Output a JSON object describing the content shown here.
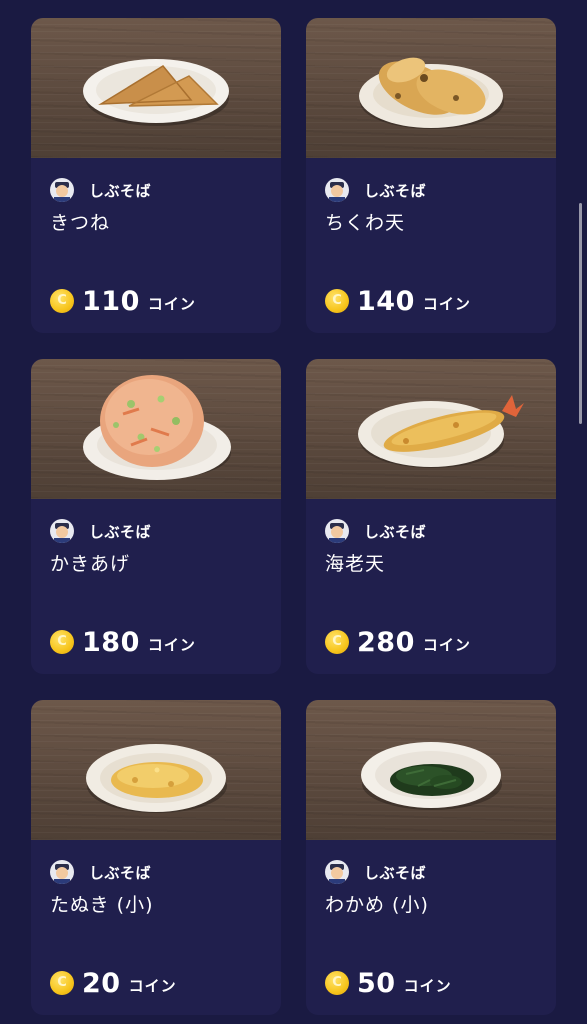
{
  "items": [
    {
      "shop": "しぶそば",
      "name": "きつね",
      "price": "110",
      "unit": "コイン",
      "photo_icon": "fried-tofu-icon"
    },
    {
      "shop": "しぶそば",
      "name": "ちくわ天",
      "price": "140",
      "unit": "コイン",
      "photo_icon": "chikuwa-tempura-icon"
    },
    {
      "shop": "しぶそば",
      "name": "かきあげ",
      "price": "180",
      "unit": "コイン",
      "photo_icon": "kakiage-icon"
    },
    {
      "shop": "しぶそば",
      "name": "海老天",
      "price": "280",
      "unit": "コイン",
      "photo_icon": "shrimp-tempura-icon"
    },
    {
      "shop": "しぶそば",
      "name": "たぬき (小)",
      "price": "20",
      "unit": "コイン",
      "photo_icon": "tempura-crumbs-icon"
    },
    {
      "shop": "しぶそば",
      "name": "わかめ (小)",
      "price": "50",
      "unit": "コイン",
      "photo_icon": "wakame-seaweed-icon"
    }
  ],
  "colors": {
    "background": "#1a1a42",
    "card": "#201f4d",
    "coin": "#f7c51c",
    "text": "#ffffff"
  }
}
